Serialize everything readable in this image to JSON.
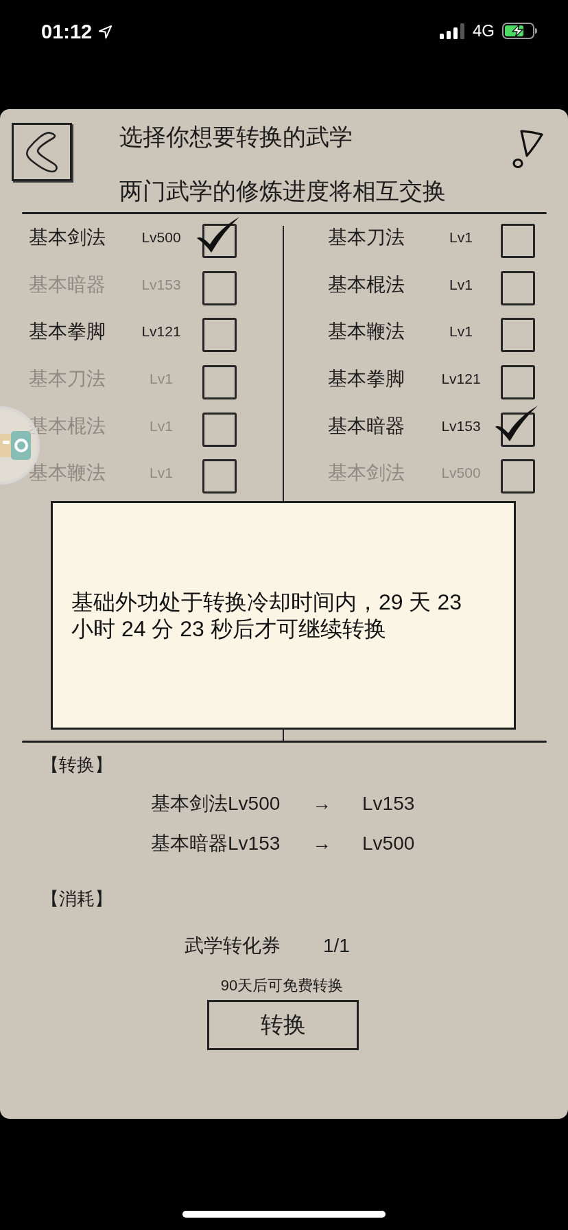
{
  "status_bar": {
    "time": "01:12",
    "network": "4G"
  },
  "header": {
    "title": "选择你想要转换的武学",
    "subtitle": "两门武学的修炼进度将相互交换"
  },
  "left_list": [
    {
      "name": "基本剑法",
      "lv": "Lv500",
      "checked": true,
      "disabled": false
    },
    {
      "name": "基本暗器",
      "lv": "Lv153",
      "checked": false,
      "disabled": true
    },
    {
      "name": "基本拳脚",
      "lv": "Lv121",
      "checked": false,
      "disabled": false
    },
    {
      "name": "基本刀法",
      "lv": "Lv1",
      "checked": false,
      "disabled": true
    },
    {
      "name": "基本棍法",
      "lv": "Lv1",
      "checked": false,
      "disabled": true
    },
    {
      "name": "基本鞭法",
      "lv": "Lv1",
      "checked": false,
      "disabled": true
    }
  ],
  "right_list": [
    {
      "name": "基本刀法",
      "lv": "Lv1",
      "checked": false,
      "disabled": false
    },
    {
      "name": "基本棍法",
      "lv": "Lv1",
      "checked": false,
      "disabled": false
    },
    {
      "name": "基本鞭法",
      "lv": "Lv1",
      "checked": false,
      "disabled": false
    },
    {
      "name": "基本拳脚",
      "lv": "Lv121",
      "checked": false,
      "disabled": false
    },
    {
      "name": "基本暗器",
      "lv": "Lv153",
      "checked": true,
      "disabled": false
    },
    {
      "name": "基本剑法",
      "lv": "Lv500",
      "checked": false,
      "disabled": true
    }
  ],
  "dialog": {
    "message": "基础外功处于转换冷却时间内，29 天 23 小时 24 分 23 秒后才可继续转换"
  },
  "conversion": {
    "heading": "【转换】",
    "rows": [
      {
        "from": "基本剑法Lv500",
        "arrow": "→",
        "to": "Lv153"
      },
      {
        "from": "基本暗器Lv153",
        "arrow": "→",
        "to": "Lv500"
      }
    ]
  },
  "cost": {
    "heading": "【消耗】",
    "items": [
      {
        "name": "武学转化券",
        "count": "1/1"
      }
    ]
  },
  "free_note": "90天后可免费转换",
  "convert_button": {
    "label": "转换"
  }
}
